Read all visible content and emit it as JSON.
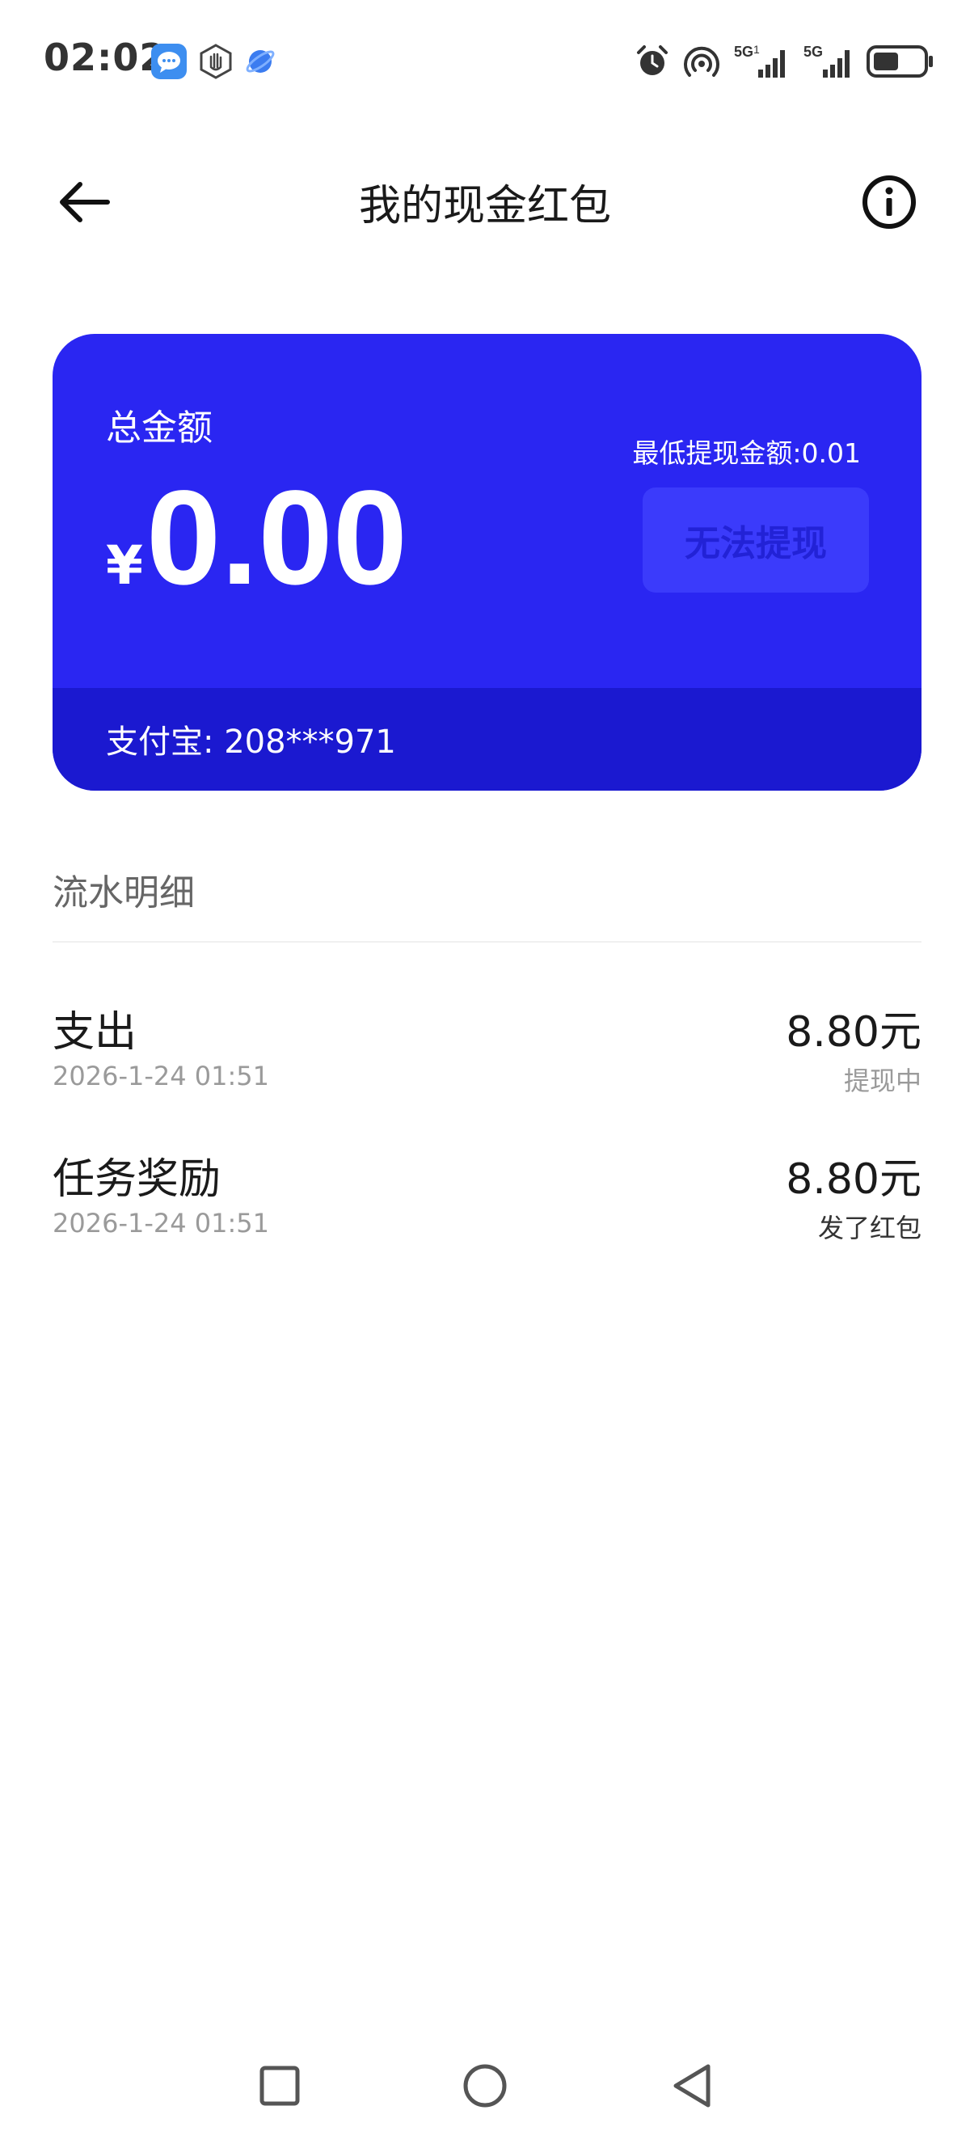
{
  "status_bar": {
    "time": "02:02",
    "left_icons": [
      "message-app-icon",
      "hand-shield-icon",
      "browser-planet-icon"
    ],
    "right_icons": [
      "alarm-clock-icon",
      "hotspot-icon",
      "signal-5g-sim1-icon",
      "signal-5g-sim2-icon",
      "battery-icon"
    ],
    "sim1_network": "5G",
    "sim1_index": "1",
    "sim2_network": "5G"
  },
  "header": {
    "title": "我的现金红包",
    "back_icon": "arrow-left-icon",
    "info_icon": "info-circle-icon"
  },
  "balance_card": {
    "total_label": "总金额",
    "currency": "¥",
    "amount": "0.00",
    "min_withdraw": "最低提现金额:0.01",
    "withdraw_button": "无法提现",
    "alipay_account": "支付宝: 208***971",
    "colors": {
      "card_bg": "#2a26f2",
      "footer_bg": "#1b19d0",
      "button_bg": "#3b3bfb",
      "button_text": "#2222d6"
    }
  },
  "transactions": {
    "section_title": "流水明细",
    "items": [
      {
        "title": "支出",
        "time": "2026-1-24 01:51",
        "amount": "8.80元",
        "status": "提现中",
        "status_color": "#9a9a9a"
      },
      {
        "title": "任务奖励",
        "time": "2026-1-24 01:51",
        "amount": "8.80元",
        "status": "发了红包",
        "status_color": "#333333"
      }
    ]
  },
  "nav_bar": {
    "buttons": [
      "recents-square-icon",
      "home-circle-icon",
      "back-triangle-icon"
    ]
  }
}
